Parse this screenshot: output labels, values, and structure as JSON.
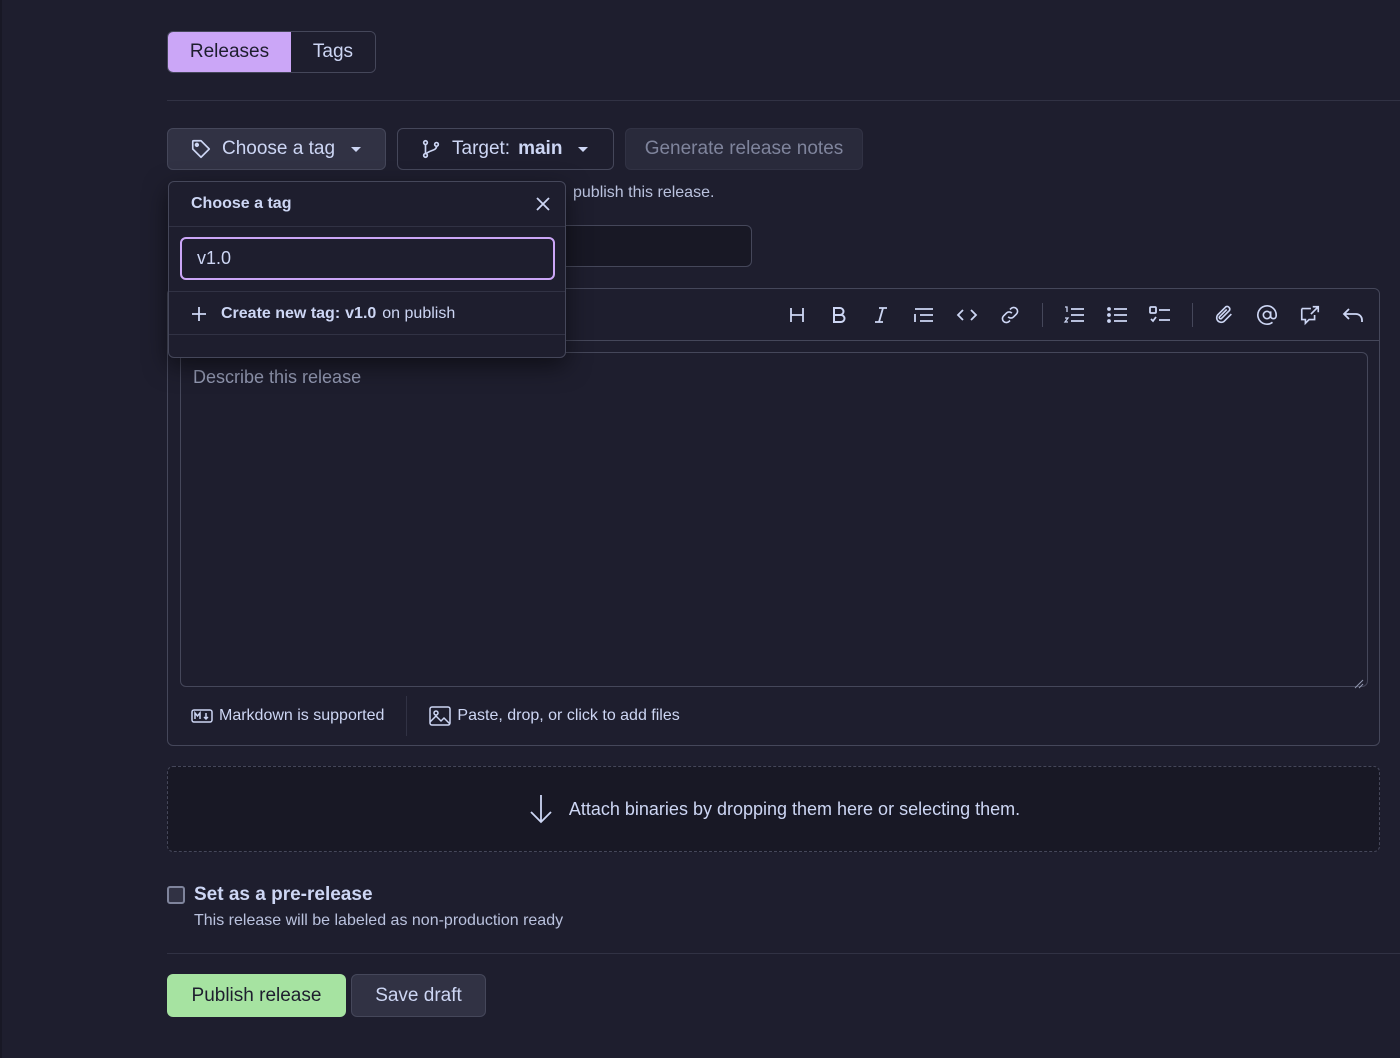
{
  "tabs": {
    "releases": "Releases",
    "tags": "Tags"
  },
  "toolbar": {
    "choose_tag_label": "Choose a tag",
    "target_label": "Target:",
    "target_value": "main",
    "generate_notes_label": "Generate release notes"
  },
  "hint_text": "publish this release.",
  "tag_dropdown": {
    "title": "Choose a tag",
    "input_value": "v1.0",
    "create_prefix": "Create new tag:",
    "create_tag_name": "v1.0",
    "create_suffix": "on publish"
  },
  "editor": {
    "placeholder": "Describe this release",
    "markdown_label": "Markdown is supported",
    "attach_label": "Paste, drop, or click to add files"
  },
  "dropzone_label": "Attach binaries by dropping them here or selecting them.",
  "prerelease": {
    "label": "Set as a pre-release",
    "description": "This release will be labeled as non-production ready"
  },
  "actions": {
    "publish": "Publish release",
    "save_draft": "Save draft"
  },
  "colors": {
    "accent": "#cba6f7",
    "publish": "#a6e3a1",
    "background": "#1e1e2e"
  }
}
